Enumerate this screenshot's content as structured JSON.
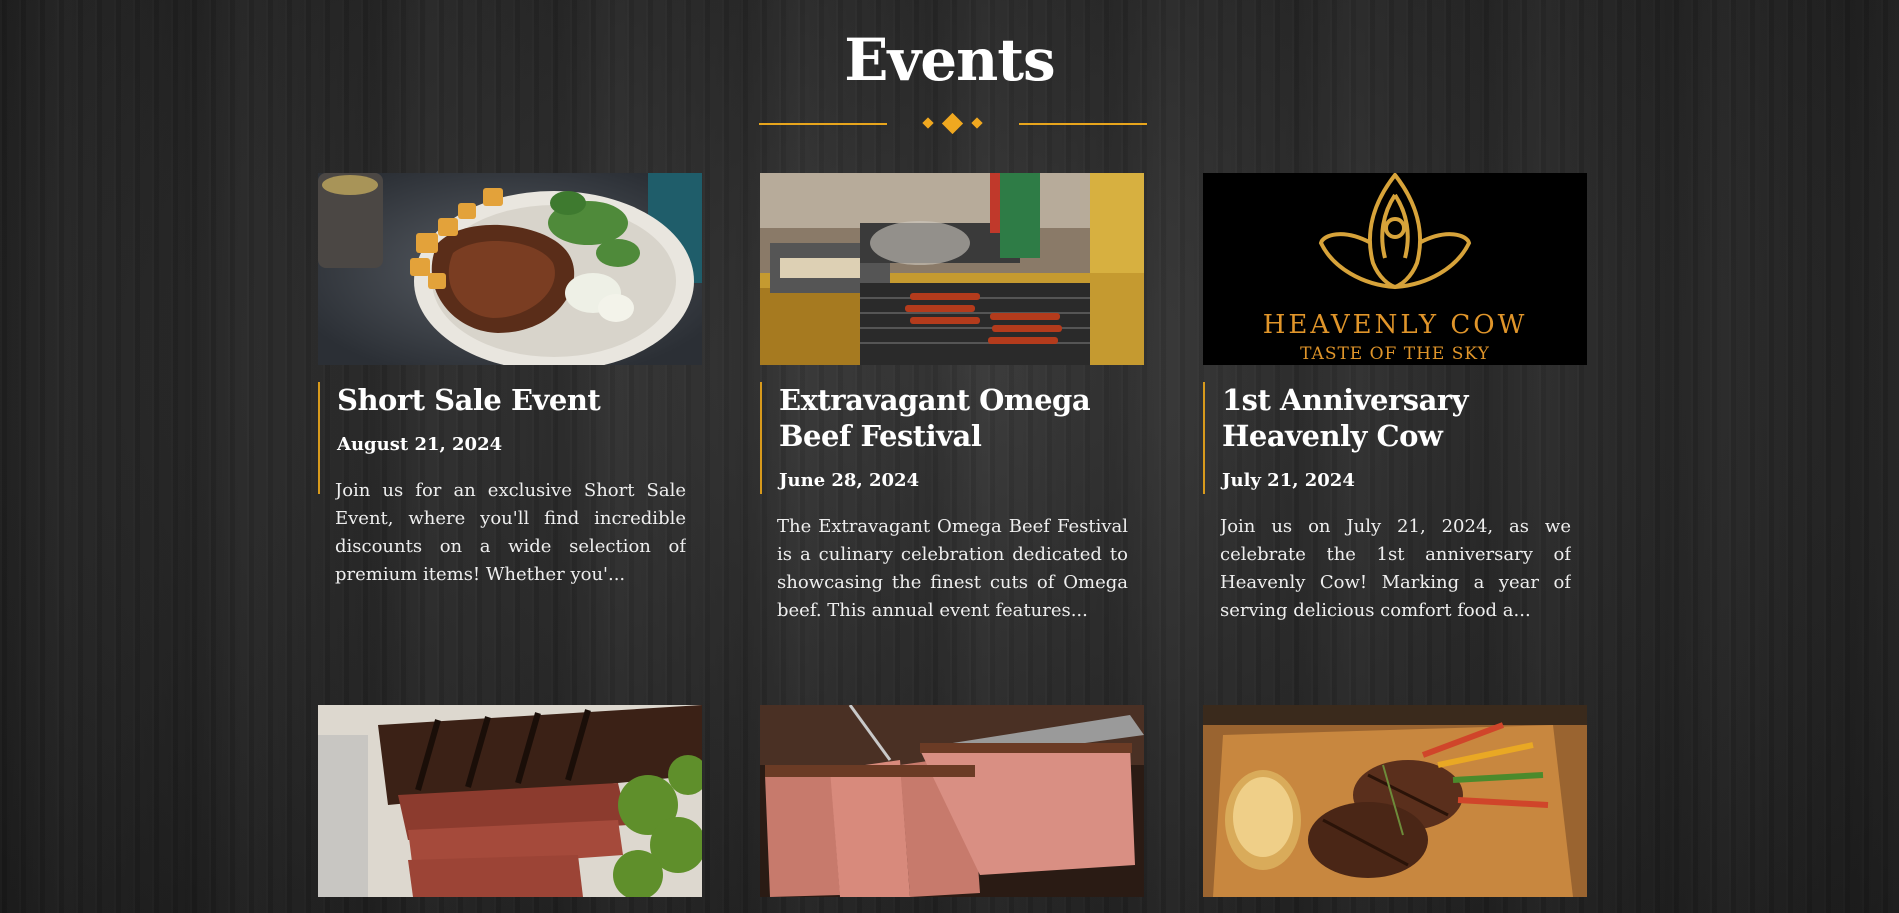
{
  "page": {
    "title": "Events"
  },
  "events": [
    {
      "title": "Short Sale Event",
      "date": "August 21, 2024",
      "description": "Join us for an exclusive Short Sale Event, where you'll find incredible discounts on a wide selection of premium items! Whether you'..."
    },
    {
      "title": "Extravagant Omega Beef Festival",
      "date": "June 28, 2024",
      "description": "The Extravagant Omega Beef Festival is a culinary celebration dedicated to showcasing the finest cuts of Omega beef. This annual event features..."
    },
    {
      "title": "1st Anniversary Heavenly Cow",
      "date": "July 21, 2024",
      "description": "Join us on July 21, 2024, as we celebrate the 1st anniversary of Heavenly Cow! Marking a year of serving delicious comfort food a...",
      "logo_text": {
        "name": "HEAVENLY COW",
        "tagline": "TASTE OF THE SKY"
      }
    }
  ],
  "colors": {
    "accent": "#e8a51c",
    "logo_gold": "#e0952a"
  }
}
